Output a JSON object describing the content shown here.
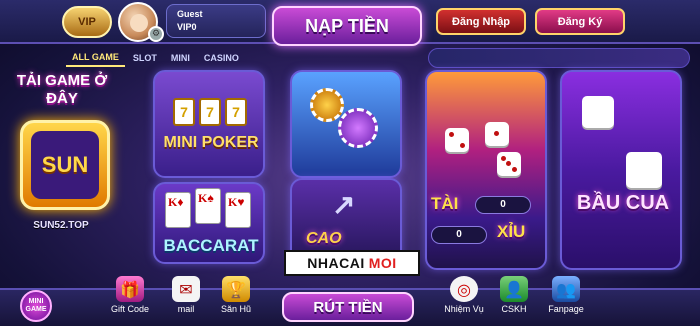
{
  "header": {
    "vip_badge": "VIP",
    "username": "Guest",
    "user_level": "VIP0",
    "deposit_label": "NẠP TIỀN",
    "login_label": "Đăng Nhập",
    "register_label": "Đăng Ký"
  },
  "tabs": [
    {
      "label": "ALL GAME",
      "active": true
    },
    {
      "label": "SLOT"
    },
    {
      "label": "MINI"
    },
    {
      "label": "CASINO"
    }
  ],
  "promo": {
    "title": "TẢI GAME Ở ĐÂY",
    "logo_text": "SUN",
    "domain": "SUN52.TOP"
  },
  "games": {
    "mini_poker": "MINI POKER",
    "baccarat": "BACCARAT",
    "cao_thap": "CAO",
    "tai": "TÀI",
    "xiu": "XỈU",
    "tai_score": "0",
    "xiu_score": "0",
    "bau_cua": "BẦU CUA"
  },
  "watermark": {
    "part1": "NHACAI",
    "part2": "MOI"
  },
  "footer": {
    "mini_game": "MINI GAME",
    "gift_code": "Gift Code",
    "mail": "mail",
    "san_hu": "Săn Hũ",
    "withdraw": "RÚT TIỀN",
    "nhiem_vu": "Nhiệm Vụ",
    "cskh": "CSKH",
    "fanpage": "Fanpage"
  },
  "colors": {
    "accent": "#c94bd6",
    "gold": "#ffd64a"
  }
}
